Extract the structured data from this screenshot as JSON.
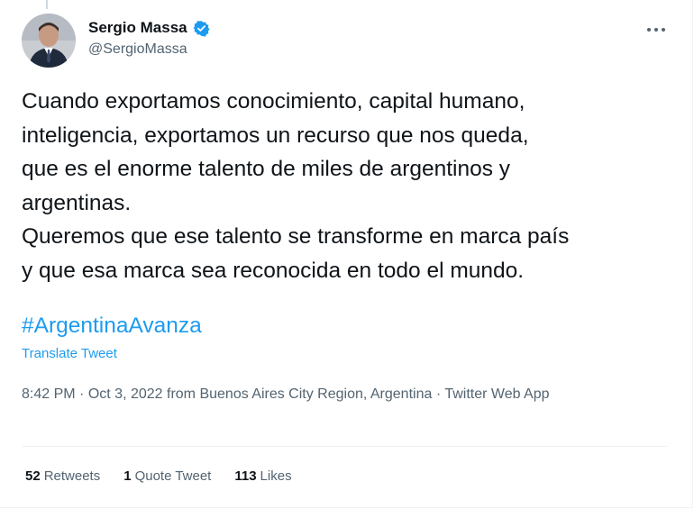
{
  "author": {
    "display_name": "Sergio Massa",
    "handle": "@SergioMassa",
    "verified": true
  },
  "tweet": {
    "text": "Cuando exportamos conocimiento, capital humano,\ninteligencia, exportamos un recurso que nos queda,\nque es el enorme talento de miles de argentinos y\nargentinas.\nQueremos que ese talento se transforme en marca país\ny que esa marca sea reconocida en todo el mundo.",
    "hashtag": "#ArgentinaAvanza",
    "translate_label": "Translate Tweet",
    "time": "8:42 PM",
    "separator": "·",
    "date": "Oct 3, 2022",
    "location": "from Buenos Aires City Region, Argentina",
    "source": "Twitter Web App"
  },
  "stats": {
    "retweets_count": "52",
    "retweets_label": "Retweets",
    "quotes_count": "1",
    "quotes_label": "Quote Tweet",
    "likes_count": "113",
    "likes_label": "Likes"
  },
  "icons": {
    "verified": "verified-badge-icon",
    "more": "more-options-icon"
  },
  "colors": {
    "accent": "#1d9bf0",
    "text_primary": "#0f1419",
    "text_secondary": "#536471",
    "divider": "#eff3f4"
  }
}
